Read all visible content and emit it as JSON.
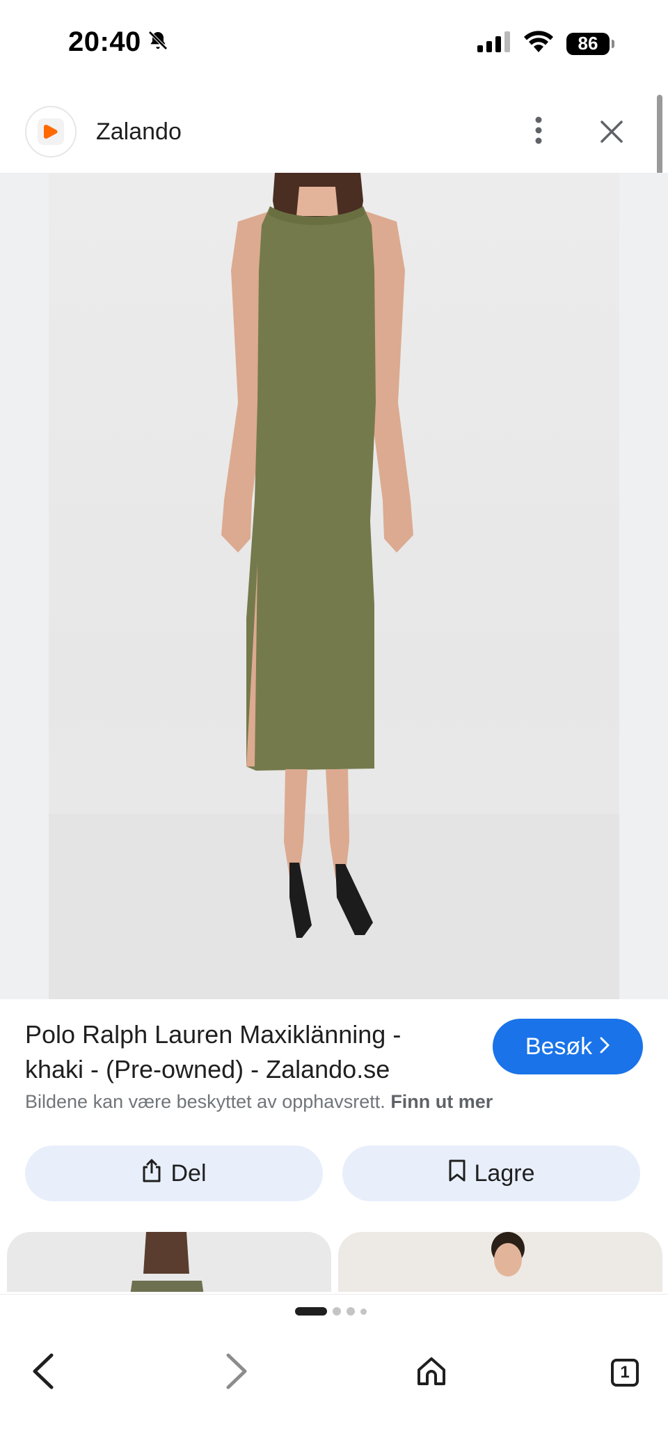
{
  "status_bar": {
    "time": "20:40",
    "battery": "86",
    "icons": [
      "bell-muted-icon",
      "cellular-signal-icon",
      "wifi-icon",
      "battery-icon"
    ]
  },
  "header": {
    "site_name": "Zalando",
    "icons": [
      "zalando-logo-icon",
      "more-vertical-icon",
      "close-icon"
    ]
  },
  "product": {
    "image_subject": "khaki sleeveless midi dress",
    "dress_color": "#757a4c"
  },
  "result": {
    "title": "Polo Ralph Lauren Maxiklänning - khaki - (Pre-owned) - Zalando.se",
    "visit_label": "Besøk",
    "copyright_text": "Bildene kan være beskyttet av opphavsrett.",
    "learn_more": "Finn ut mer",
    "share_label": "Del",
    "save_label": "Lagre"
  },
  "bottom_bar": {
    "tab_count": "1",
    "icons": [
      "back-arrow-icon",
      "forward-arrow-icon",
      "home-icon",
      "tabs-icon"
    ]
  },
  "colors": {
    "accent": "#1a73e8",
    "zalando_orange": "#ff6900",
    "pill_background": "#e8effb"
  }
}
